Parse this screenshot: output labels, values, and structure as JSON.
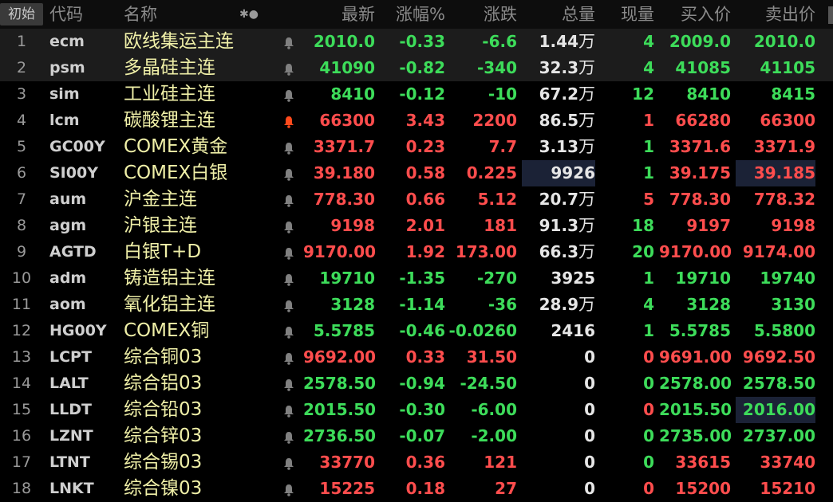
{
  "colors": {
    "up": "#ff4d4d",
    "down": "#3ddc5a",
    "neutral": "#e6e6e6",
    "bell_off": "#808080",
    "bell_on": "#ff4a1c"
  },
  "header": {
    "reset": "初始",
    "code": "代码",
    "name": "名称",
    "icons": "✱●",
    "last": "最新",
    "pct": "涨幅%",
    "chg": "涨跌",
    "vol": "总量",
    "cur": "现量",
    "bid": "买入价",
    "ask": "卖出价"
  },
  "rows": [
    {
      "idx": "1",
      "code": "ecm",
      "name": "欧线集运主连",
      "bell": "off",
      "last": "2010.0",
      "pct": "-0.33",
      "chg": "-6.6",
      "vol": "1.44",
      "vol_unit": "万",
      "cur": "4",
      "bid": "2009.0",
      "ask": "2010.0",
      "dir": "down",
      "cur_dir": "down",
      "hl": true
    },
    {
      "idx": "2",
      "code": "psm",
      "name": "多晶硅主连",
      "bell": "off",
      "last": "41090",
      "pct": "-0.82",
      "chg": "-340",
      "vol": "32.3",
      "vol_unit": "万",
      "cur": "4",
      "bid": "41085",
      "ask": "41105",
      "dir": "down",
      "cur_dir": "down",
      "hl": true
    },
    {
      "idx": "3",
      "code": "sim",
      "name": "工业硅主连",
      "bell": "off",
      "last": "8410",
      "pct": "-0.12",
      "chg": "-10",
      "vol": "67.2",
      "vol_unit": "万",
      "cur": "12",
      "bid": "8410",
      "ask": "8415",
      "dir": "down",
      "cur_dir": "down"
    },
    {
      "idx": "4",
      "code": "lcm",
      "name": "碳酸锂主连",
      "bell": "on",
      "last": "66300",
      "pct": "3.43",
      "chg": "2200",
      "vol": "86.5",
      "vol_unit": "万",
      "cur": "1",
      "bid": "66280",
      "ask": "66300",
      "dir": "up",
      "cur_dir": "up"
    },
    {
      "idx": "5",
      "code": "GC00Y",
      "name": "COMEX黄金",
      "bell": "off",
      "last": "3371.7",
      "pct": "0.23",
      "chg": "7.7",
      "vol": "3.13",
      "vol_unit": "万",
      "cur": "1",
      "bid": "3371.6",
      "ask": "3371.9",
      "dir": "up",
      "cur_dir": "down"
    },
    {
      "idx": "6",
      "code": "SI00Y",
      "name": "COMEX白银",
      "bell": "off",
      "last": "39.180",
      "pct": "0.58",
      "chg": "0.225",
      "vol": "9926",
      "vol_unit": "",
      "cur": "1",
      "bid": "39.175",
      "ask": "39.185",
      "dir": "up",
      "cur_dir": "down",
      "box_vol": true,
      "box_ask": true
    },
    {
      "idx": "7",
      "code": "aum",
      "name": "沪金主连",
      "bell": "off",
      "last": "778.30",
      "pct": "0.66",
      "chg": "5.12",
      "vol": "20.7",
      "vol_unit": "万",
      "cur": "5",
      "bid": "778.30",
      "ask": "778.32",
      "dir": "up",
      "cur_dir": "up"
    },
    {
      "idx": "8",
      "code": "agm",
      "name": "沪银主连",
      "bell": "off",
      "last": "9198",
      "pct": "2.01",
      "chg": "181",
      "vol": "91.3",
      "vol_unit": "万",
      "cur": "18",
      "bid": "9197",
      "ask": "9198",
      "dir": "up",
      "cur_dir": "down"
    },
    {
      "idx": "9",
      "code": "AGTD",
      "name": "白银T+D",
      "bell": "off",
      "last": "9170.00",
      "pct": "1.92",
      "chg": "173.00",
      "vol": "66.3",
      "vol_unit": "万",
      "cur": "20",
      "bid": "9170.00",
      "ask": "9174.00",
      "dir": "up",
      "cur_dir": "down"
    },
    {
      "idx": "10",
      "code": "adm",
      "name": "铸造铝主连",
      "bell": "off",
      "last": "19710",
      "pct": "-1.35",
      "chg": "-270",
      "vol": "3925",
      "vol_unit": "",
      "cur": "1",
      "bid": "19710",
      "ask": "19740",
      "dir": "down",
      "cur_dir": "down"
    },
    {
      "idx": "11",
      "code": "aom",
      "name": "氧化铝主连",
      "bell": "off",
      "last": "3128",
      "pct": "-1.14",
      "chg": "-36",
      "vol": "28.9",
      "vol_unit": "万",
      "cur": "4",
      "bid": "3128",
      "ask": "3130",
      "dir": "down",
      "cur_dir": "down"
    },
    {
      "idx": "12",
      "code": "HG00Y",
      "name": "COMEX铜",
      "bell": "off",
      "last": "5.5785",
      "pct": "-0.46",
      "chg": "-0.0260",
      "vol": "2416",
      "vol_unit": "",
      "cur": "1",
      "bid": "5.5785",
      "ask": "5.5800",
      "dir": "down",
      "cur_dir": "down"
    },
    {
      "idx": "13",
      "code": "LCPT",
      "name": "综合铜03",
      "bell": "off",
      "last": "9692.00",
      "pct": "0.33",
      "chg": "31.50",
      "vol": "0",
      "vol_unit": "",
      "cur": "0",
      "bid": "9691.00",
      "ask": "9692.50",
      "dir": "up",
      "cur_dir": "up"
    },
    {
      "idx": "14",
      "code": "LALT",
      "name": "综合铝03",
      "bell": "off",
      "last": "2578.50",
      "pct": "-0.94",
      "chg": "-24.50",
      "vol": "0",
      "vol_unit": "",
      "cur": "0",
      "bid": "2578.00",
      "ask": "2578.50",
      "dir": "down",
      "cur_dir": "down"
    },
    {
      "idx": "15",
      "code": "LLDT",
      "name": "综合铅03",
      "bell": "off",
      "last": "2015.50",
      "pct": "-0.30",
      "chg": "-6.00",
      "vol": "0",
      "vol_unit": "",
      "cur": "0",
      "bid": "2015.50",
      "ask": "2016.00",
      "dir": "down",
      "cur_dir": "up",
      "box_ask": true
    },
    {
      "idx": "16",
      "code": "LZNT",
      "name": "综合锌03",
      "bell": "off",
      "last": "2736.50",
      "pct": "-0.07",
      "chg": "-2.00",
      "vol": "0",
      "vol_unit": "",
      "cur": "0",
      "bid": "2735.00",
      "ask": "2737.00",
      "dir": "down",
      "cur_dir": "down"
    },
    {
      "idx": "17",
      "code": "LTNT",
      "name": "综合锡03",
      "bell": "off",
      "last": "33770",
      "pct": "0.36",
      "chg": "121",
      "vol": "0",
      "vol_unit": "",
      "cur": "0",
      "bid": "33615",
      "ask": "33740",
      "dir": "up",
      "cur_dir": "down"
    },
    {
      "idx": "18",
      "code": "LNKT",
      "name": "综合镍03",
      "bell": "off",
      "last": "15225",
      "pct": "0.18",
      "chg": "27",
      "vol": "0",
      "vol_unit": "",
      "cur": "0",
      "bid": "15200",
      "ask": "15210",
      "dir": "up",
      "cur_dir": "up"
    }
  ]
}
